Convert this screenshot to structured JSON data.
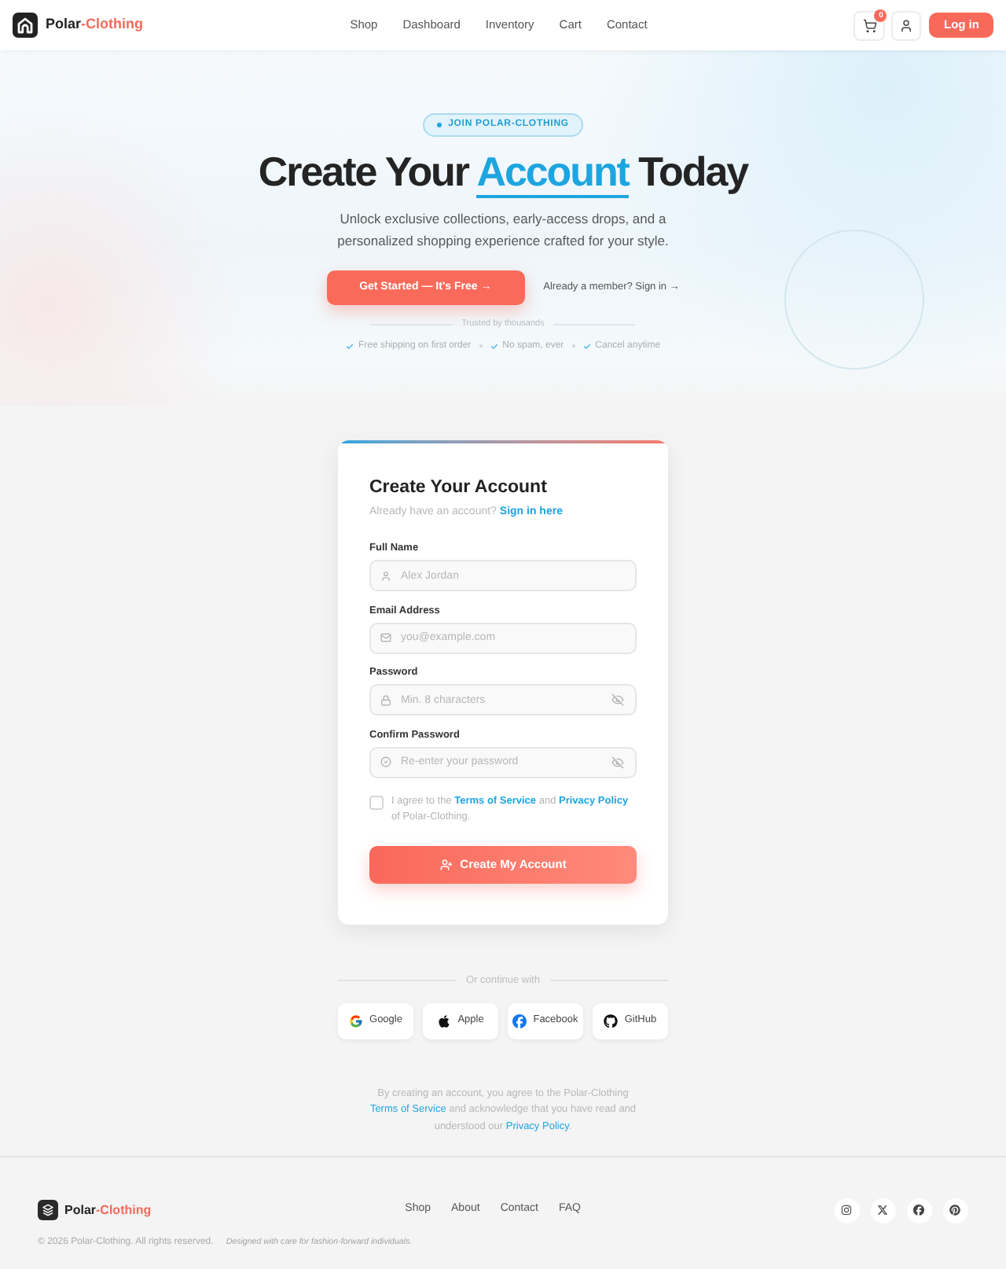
{
  "header": {
    "brand": {
      "name": "Polar",
      "accent": "-Clothing"
    },
    "nav": [
      {
        "label": "Shop"
      },
      {
        "label": "Dashboard"
      },
      {
        "label": "Inventory"
      },
      {
        "label": "Cart"
      },
      {
        "label": "Contact"
      }
    ],
    "cart_count": "0",
    "login": "Log in"
  },
  "hero": {
    "badge": "JOIN POLAR-CLOTHING",
    "title": {
      "before": "Create Your",
      "highlight": "Account",
      "after": "Today"
    },
    "subtitle": "Unlock exclusive collections, early-access drops, and a personalized shopping experience crafted for your style.",
    "primary_button": "Get Started — It's Free →",
    "member_link": "Already a member? Sign in →",
    "trust_label": "Trusted by thousands",
    "perks": [
      "Free shipping on first order",
      "No spam, ever",
      "Cancel anytime"
    ]
  },
  "form": {
    "title": "Create Your Account",
    "prompt": "Already have an account?",
    "prompt_link": "Sign in here",
    "fields": [
      {
        "kind": "name",
        "label": "Full Name",
        "placeholder": "Alex Jordan"
      },
      {
        "kind": "email",
        "label": "Email Address",
        "placeholder": "you@example.com"
      },
      {
        "kind": "password",
        "label": "Password",
        "placeholder": "Min. 8 characters"
      },
      {
        "kind": "confirm",
        "label": "Confirm Password",
        "placeholder": "Re-enter your password"
      }
    ],
    "agreement": {
      "checked": false,
      "segments": [
        {
          "kind": "text",
          "text": "I agree to the "
        },
        {
          "kind": "link",
          "text": "Terms of Service"
        },
        {
          "kind": "text",
          "text": " and "
        },
        {
          "kind": "link",
          "text": "Privacy Policy"
        },
        {
          "kind": "text",
          "text": " of Polar-Clothing."
        }
      ]
    },
    "submit": "Create My Account"
  },
  "social": {
    "divider_label": "Or continue with",
    "providers": [
      {
        "kind": "google",
        "label": "Google"
      },
      {
        "kind": "apple",
        "label": "Apple"
      },
      {
        "kind": "facebook",
        "label": "Facebook"
      },
      {
        "kind": "github",
        "label": "GitHub"
      }
    ]
  },
  "legal": {
    "segments": [
      {
        "kind": "text",
        "text": "By creating an account, you agree to the Polar-Clothing "
      },
      {
        "kind": "link",
        "text": "Terms of Service"
      },
      {
        "kind": "text",
        "text": " and acknowledge that you have read and understood our "
      },
      {
        "kind": "link",
        "text": "Privacy Policy"
      },
      {
        "kind": "text",
        "text": "."
      }
    ]
  },
  "footer": {
    "brand": {
      "name": "Polar",
      "accent": "-Clothing"
    },
    "nav": [
      {
        "label": "Shop"
      },
      {
        "label": "About"
      },
      {
        "label": "Contact"
      },
      {
        "label": "FAQ"
      }
    ],
    "copyright": "© 2026 Polar-Clothing. All rights reserved.",
    "tagline": "Designed with care for fashion-forward individuals."
  }
}
